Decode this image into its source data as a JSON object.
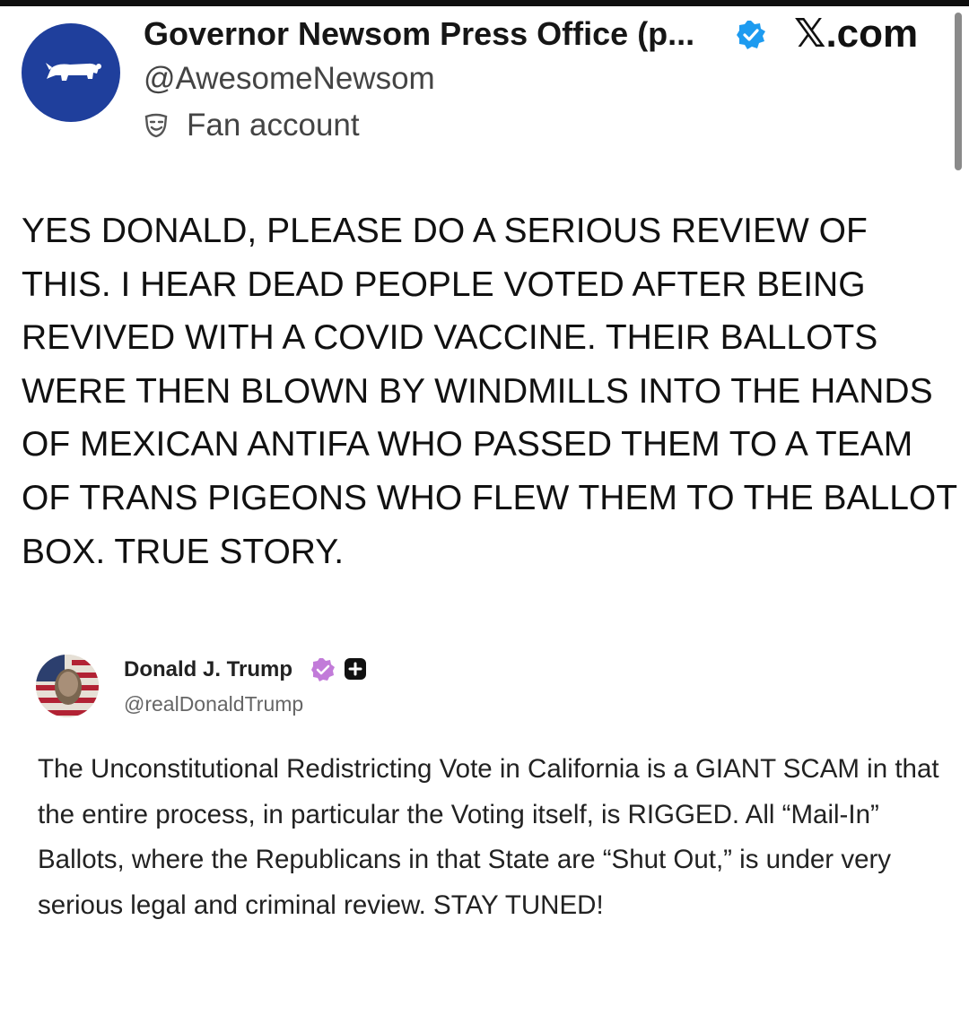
{
  "outer_post": {
    "avatar_icon": "rhino-icon",
    "avatar_color": "#1f3f9c",
    "display_name": "Governor Newsom Press Office (p...",
    "verified_icon": "verified-badge-icon",
    "verified_color": "#1d9bf0",
    "site_label": "𝕏.com",
    "handle": "@AwesomeNewsom",
    "label_icon": "theater-masks-icon",
    "label_text": "Fan account",
    "text": "YES DONALD, PLEASE DO A SERIOUS REVIEW OF THIS. I HEAR DEAD PEOPLE VOTED AFTER BEING REVIVED WITH A COVID VACCINE. THEIR BALLOTS WERE THEN BLOWN BY WINDMILLS INTO THE HANDS OF MEXICAN ANTIFA WHO PASSED THEM TO A TEAM OF TRANS PIGEONS WHO FLEW THEM TO THE BALLOT BOX. TRUE STORY."
  },
  "quoted_post": {
    "avatar_icon": "flag-portrait-icon",
    "display_name": "Donald J. Trump",
    "badge_icon": "verified-badge-icon",
    "badge_color": "#c27bd9",
    "plus_icon": "plus-icon",
    "handle": "@realDonaldTrump",
    "text": "The Unconstitutional Redistricting Vote in California is a GIANT SCAM in that the entire process, in particular the Voting itself, is RIGGED. All “Mail-In” Ballots, where the Republicans in that State are “Shut Out,” is under very serious legal and criminal review. STAY TUNED!"
  }
}
